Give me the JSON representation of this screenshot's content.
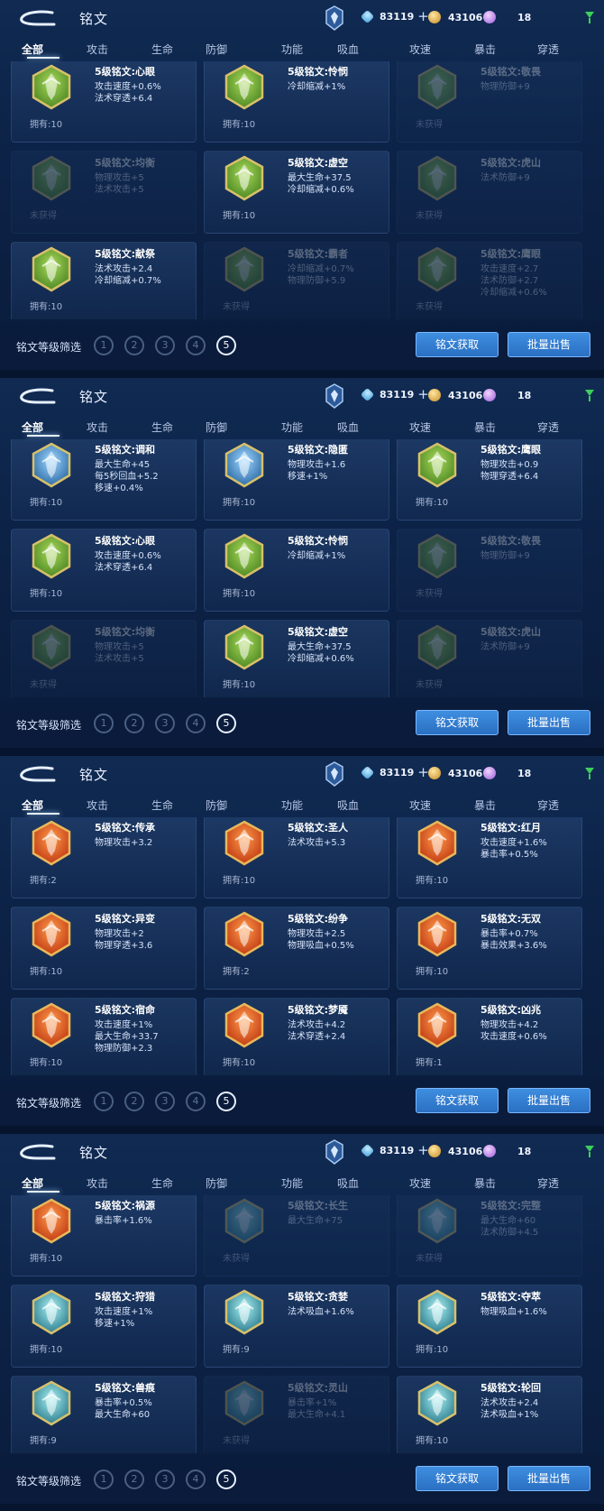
{
  "header": {
    "title": "铭文",
    "gems": "83119",
    "gold": "43106",
    "crystals": "18"
  },
  "tabs": [
    "全部",
    "攻击",
    "生命",
    "防御",
    "功能",
    "吸血",
    "攻速",
    "暴击",
    "穿透"
  ],
  "filter": {
    "label": "铭文等级筛选",
    "levels": [
      "1",
      "2",
      "3",
      "4",
      "5"
    ],
    "active_level": "5"
  },
  "buttons": {
    "acquire": "铭文获取",
    "bulk_sell": "批量出售"
  },
  "colors": {
    "green": "#6fae3c",
    "blue": "#4a8ec8",
    "red": "#d8501e",
    "teal": "#52a2b4"
  },
  "panels": [
    {
      "cards": [
        {
          "name": "5级铭文:心眼",
          "stats": [
            "攻击速度+0.6%",
            "法术穿透+6.4"
          ],
          "owned": "拥有:10",
          "color": "green",
          "icon": "rune-green-icon",
          "dim": false
        },
        {
          "name": "5级铭文:怜悯",
          "stats": [
            "冷却缩减+1%"
          ],
          "owned": "拥有:10",
          "color": "green",
          "icon": "rune-green-icon",
          "dim": false
        },
        {
          "name": "5级铭文:敬畏",
          "stats": [
            "物理防御+9"
          ],
          "owned": "未获得",
          "color": "green",
          "icon": "rune-green-icon",
          "dim": true
        },
        {
          "name": "5级铭文:均衡",
          "stats": [
            "物理攻击+5",
            "法术攻击+5"
          ],
          "owned": "未获得",
          "color": "green",
          "icon": "rune-green-icon",
          "dim": true
        },
        {
          "name": "5级铭文:虚空",
          "stats": [
            "最大生命+37.5",
            "冷却缩减+0.6%"
          ],
          "owned": "拥有:10",
          "color": "green",
          "icon": "rune-green-icon",
          "dim": false
        },
        {
          "name": "5级铭文:虎山",
          "stats": [
            "法术防御+9"
          ],
          "owned": "未获得",
          "color": "green",
          "icon": "rune-green-icon",
          "dim": true
        },
        {
          "name": "5级铭文:献祭",
          "stats": [
            "法术攻击+2.4",
            "冷却缩减+0.7%"
          ],
          "owned": "拥有:10",
          "color": "green",
          "icon": "rune-green-icon",
          "dim": false
        },
        {
          "name": "5级铭文:霸者",
          "stats": [
            "冷却缩减+0.7%",
            "物理防御+5.9"
          ],
          "owned": "未获得",
          "color": "green",
          "icon": "rune-green-icon",
          "dim": true
        },
        {
          "name": "5级铭文:鹰眼",
          "stats": [
            "攻击速度+2.7",
            "法术防御+2.7",
            "冷却缩减+0.6%"
          ],
          "owned": "未获得",
          "color": "green",
          "icon": "rune-green-icon",
          "dim": true
        }
      ]
    },
    {
      "cards": [
        {
          "name": "5级铭文:调和",
          "stats": [
            "最大生命+45",
            "每5秒回血+5.2",
            "移速+0.4%"
          ],
          "owned": "拥有:10",
          "color": "blue",
          "icon": "rune-blue-icon",
          "dim": false
        },
        {
          "name": "5级铭文:隐匿",
          "stats": [
            "物理攻击+1.6",
            "移速+1%"
          ],
          "owned": "拥有:10",
          "color": "blue",
          "icon": "rune-blue-icon",
          "dim": false
        },
        {
          "name": "5级铭文:鹰眼",
          "stats": [
            "物理攻击+0.9",
            "物理穿透+6.4"
          ],
          "owned": "拥有:10",
          "color": "green",
          "icon": "rune-green-icon",
          "dim": false
        },
        {
          "name": "5级铭文:心眼",
          "stats": [
            "攻击速度+0.6%",
            "法术穿透+6.4"
          ],
          "owned": "拥有:10",
          "color": "green",
          "icon": "rune-green-icon",
          "dim": false
        },
        {
          "name": "5级铭文:怜悯",
          "stats": [
            "冷却缩减+1%"
          ],
          "owned": "拥有:10",
          "color": "green",
          "icon": "rune-green-icon",
          "dim": false
        },
        {
          "name": "5级铭文:敬畏",
          "stats": [
            "物理防御+9"
          ],
          "owned": "未获得",
          "color": "green",
          "icon": "rune-green-icon",
          "dim": true
        },
        {
          "name": "5级铭文:均衡",
          "stats": [
            "物理攻击+5",
            "法术攻击+5"
          ],
          "owned": "未获得",
          "color": "green",
          "icon": "rune-green-icon",
          "dim": true
        },
        {
          "name": "5级铭文:虚空",
          "stats": [
            "最大生命+37.5",
            "冷却缩减+0.6%"
          ],
          "owned": "拥有:10",
          "color": "green",
          "icon": "rune-green-icon",
          "dim": false
        },
        {
          "name": "5级铭文:虎山",
          "stats": [
            "法术防御+9"
          ],
          "owned": "未获得",
          "color": "green",
          "icon": "rune-green-icon",
          "dim": true
        }
      ]
    },
    {
      "cards": [
        {
          "name": "5级铭文:传承",
          "stats": [
            "物理攻击+3.2"
          ],
          "owned": "拥有:2",
          "color": "red",
          "icon": "rune-red-icon",
          "dim": false
        },
        {
          "name": "5级铭文:圣人",
          "stats": [
            "法术攻击+5.3"
          ],
          "owned": "拥有:10",
          "color": "red",
          "icon": "rune-red-icon",
          "dim": false
        },
        {
          "name": "5级铭文:红月",
          "stats": [
            "攻击速度+1.6%",
            "暴击率+0.5%"
          ],
          "owned": "拥有:10",
          "color": "red",
          "icon": "rune-red-icon",
          "dim": false
        },
        {
          "name": "5级铭文:异变",
          "stats": [
            "物理攻击+2",
            "物理穿透+3.6"
          ],
          "owned": "拥有:10",
          "color": "red",
          "icon": "rune-red-icon",
          "dim": false
        },
        {
          "name": "5级铭文:纷争",
          "stats": [
            "物理攻击+2.5",
            "物理吸血+0.5%"
          ],
          "owned": "拥有:2",
          "color": "red",
          "icon": "rune-red-icon",
          "dim": false
        },
        {
          "name": "5级铭文:无双",
          "stats": [
            "暴击率+0.7%",
            "暴击效果+3.6%"
          ],
          "owned": "拥有:10",
          "color": "red",
          "icon": "rune-red-icon",
          "dim": false
        },
        {
          "name": "5级铭文:宿命",
          "stats": [
            "攻击速度+1%",
            "最大生命+33.7",
            "物理防御+2.3"
          ],
          "owned": "拥有:10",
          "color": "red",
          "icon": "rune-red-icon",
          "dim": false
        },
        {
          "name": "5级铭文:梦魇",
          "stats": [
            "法术攻击+4.2",
            "法术穿透+2.4"
          ],
          "owned": "拥有:10",
          "color": "red",
          "icon": "rune-red-icon",
          "dim": false
        },
        {
          "name": "5级铭文:凶兆",
          "stats": [
            "物理攻击+4.2",
            "攻击速度+0.6%"
          ],
          "owned": "拥有:1",
          "color": "red",
          "icon": "rune-red-icon",
          "dim": false
        }
      ]
    },
    {
      "cards": [
        {
          "name": "5级铭文:祸源",
          "stats": [
            "暴击率+1.6%"
          ],
          "owned": "拥有:10",
          "color": "red",
          "icon": "rune-red-icon",
          "dim": false
        },
        {
          "name": "5级铭文:长生",
          "stats": [
            "最大生命+75"
          ],
          "owned": "未获得",
          "color": "teal",
          "icon": "rune-teal-icon",
          "dim": true
        },
        {
          "name": "5级铭文:完整",
          "stats": [
            "最大生命+60",
            "法术防御+4.5"
          ],
          "owned": "未获得",
          "color": "teal",
          "icon": "rune-teal-icon",
          "dim": true
        },
        {
          "name": "5级铭文:狩猎",
          "stats": [
            "攻击速度+1%",
            "移速+1%"
          ],
          "owned": "拥有:10",
          "color": "teal",
          "icon": "rune-teal-icon",
          "dim": false
        },
        {
          "name": "5级铭文:贪婪",
          "stats": [
            "法术吸血+1.6%"
          ],
          "owned": "拥有:9",
          "color": "teal",
          "icon": "rune-teal-icon",
          "dim": false
        },
        {
          "name": "5级铭文:夺萃",
          "stats": [
            "物理吸血+1.6%"
          ],
          "owned": "拥有:10",
          "color": "teal",
          "icon": "rune-teal-icon",
          "dim": false
        },
        {
          "name": "5级铭文:兽痕",
          "stats": [
            "暴击率+0.5%",
            "最大生命+60"
          ],
          "owned": "拥有:9",
          "color": "teal",
          "icon": "rune-teal-icon",
          "dim": false
        },
        {
          "name": "5级铭文:灵山",
          "stats": [
            "暴击率+1%",
            "最大生命+4.1"
          ],
          "owned": "未获得",
          "color": "teal",
          "icon": "rune-teal-icon",
          "dim": true
        },
        {
          "name": "5级铭文:轮回",
          "stats": [
            "法术攻击+2.4",
            "法术吸血+1%"
          ],
          "owned": "拥有:10",
          "color": "teal",
          "icon": "rune-teal-icon",
          "dim": false
        }
      ]
    }
  ]
}
